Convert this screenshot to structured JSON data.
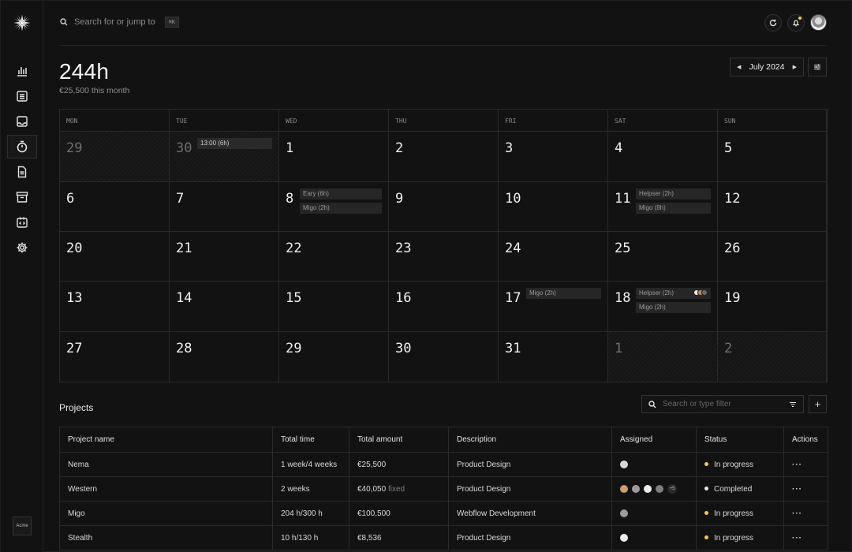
{
  "header": {
    "search_placeholder": "Search for or jump to",
    "search_shortcut": "⌘K"
  },
  "sidebar": {
    "items": [
      {
        "icon": "bar-chart-icon"
      },
      {
        "icon": "list-icon"
      },
      {
        "icon": "inbox-icon"
      },
      {
        "icon": "timer-icon",
        "active": true
      },
      {
        "icon": "document-icon"
      },
      {
        "icon": "archive-icon"
      },
      {
        "icon": "code-icon"
      },
      {
        "icon": "settings-gear-icon"
      }
    ],
    "workspace_label": "Acme"
  },
  "summary": {
    "hours": "244h",
    "earnings": "€25,500 this month"
  },
  "month_picker": {
    "label": "July 2024"
  },
  "calendar": {
    "weekdays": [
      "MON",
      "TUE",
      "WED",
      "THU",
      "FRI",
      "SAT",
      "SUN"
    ],
    "weeks": [
      [
        {
          "day": "29",
          "muted": true,
          "events": []
        },
        {
          "day": "30",
          "muted": true,
          "events": [
            "13:00 (6h)"
          ],
          "bright": true
        },
        {
          "day": "1",
          "events": []
        },
        {
          "day": "2",
          "events": []
        },
        {
          "day": "3",
          "events": []
        },
        {
          "day": "4",
          "events": []
        },
        {
          "day": "5",
          "events": []
        }
      ],
      [
        {
          "day": "6",
          "events": []
        },
        {
          "day": "7",
          "events": []
        },
        {
          "day": "8",
          "events": [
            "Eary (6h)",
            "Migo (2h)"
          ]
        },
        {
          "day": "9",
          "events": []
        },
        {
          "day": "10",
          "events": []
        },
        {
          "day": "11",
          "events": [
            "Helpser (2h)",
            "Migo (8h)"
          ]
        },
        {
          "day": "12",
          "events": []
        }
      ],
      [
        {
          "day": "20",
          "events": []
        },
        {
          "day": "21",
          "events": []
        },
        {
          "day": "22",
          "events": []
        },
        {
          "day": "23",
          "events": []
        },
        {
          "day": "24",
          "events": []
        },
        {
          "day": "25",
          "events": []
        },
        {
          "day": "26",
          "events": []
        }
      ],
      [
        {
          "day": "13",
          "events": []
        },
        {
          "day": "14",
          "events": []
        },
        {
          "day": "15",
          "events": []
        },
        {
          "day": "16",
          "events": []
        },
        {
          "day": "17",
          "events": [
            "Migo (2h)"
          ]
        },
        {
          "day": "18",
          "events": [
            "Helpser (2h)",
            "Migo (2h)"
          ],
          "avatars": true
        },
        {
          "day": "19",
          "events": []
        }
      ],
      [
        {
          "day": "27",
          "events": []
        },
        {
          "day": "28",
          "events": []
        },
        {
          "day": "29",
          "events": []
        },
        {
          "day": "30",
          "events": []
        },
        {
          "day": "31",
          "events": []
        },
        {
          "day": "1",
          "muted": true,
          "events": []
        },
        {
          "day": "2",
          "muted": true,
          "events": []
        }
      ]
    ]
  },
  "projects": {
    "title": "Projects",
    "search_placeholder": "Search or type filter",
    "add_label": "+",
    "columns": [
      "Project name",
      "Total time",
      "Total amount",
      "Description",
      "Assigned",
      "Status",
      "Actions"
    ],
    "rows": [
      {
        "name": "Nema",
        "time": "1 week/4 weeks",
        "amount": "€25,500",
        "fixed": "",
        "description": "Product Design",
        "assignees": 1,
        "extra": "",
        "status": "In progress",
        "status_color": "#f2c94c"
      },
      {
        "name": "Western",
        "time": "2 weeks",
        "amount": "€40,050",
        "fixed": "fixed",
        "description": "Product Design",
        "assignees": 4,
        "extra": "+5",
        "status": "Completed",
        "status_color": "#e6e6e6"
      },
      {
        "name": "Migo",
        "time": "204 h/300 h",
        "amount": "€100,500",
        "fixed": "",
        "description": "Webflow Development",
        "assignees": 1,
        "extra": "",
        "status": "In progress",
        "status_color": "#f2c94c"
      },
      {
        "name": "Stealth",
        "time": "10 h/130 h",
        "amount": "€8,536",
        "fixed": "",
        "description": "Product Design",
        "assignees": 1,
        "extra": "",
        "status": "In progress",
        "status_color": "#f2c94c"
      }
    ],
    "actions_label": "···"
  }
}
